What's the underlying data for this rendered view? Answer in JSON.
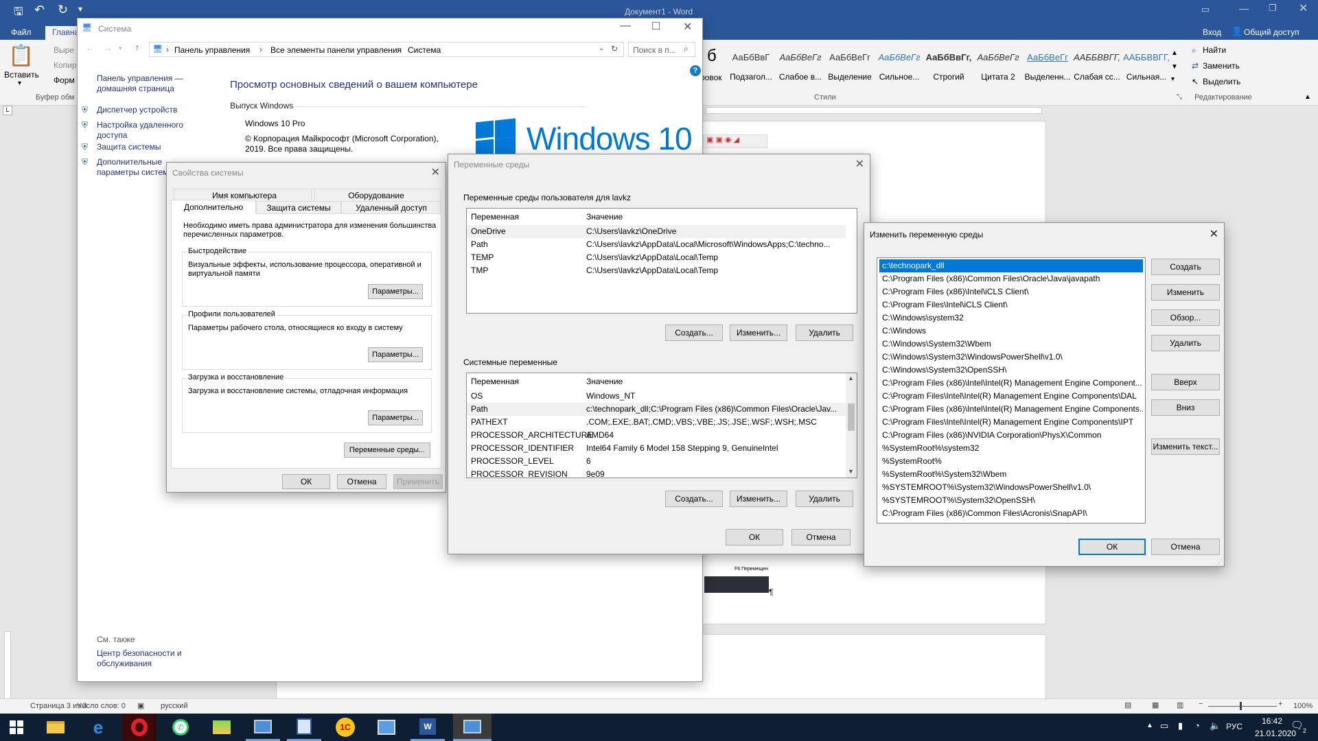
{
  "word": {
    "doc_title": "Документ1 - Word",
    "login": "Вход",
    "share": "Общий доступ",
    "tab_file": "Файл",
    "tab_home": "Главна",
    "paste": "Вставить",
    "cut": "Выре",
    "copy": "Копир",
    "format": "Форм",
    "clipboard": "Буфер обм",
    "styles_group": "Стили",
    "editing_group": "Редактирование",
    "find": "Найти",
    "replace": "Заменить",
    "select": "Выделить",
    "styles": [
      {
        "sample": "АаБбВвГ",
        "name": "Подзагол..."
      },
      {
        "sample": "АаБбВеГг",
        "name": "Слабое в..."
      },
      {
        "sample": "АаБбВеГг",
        "name": "Выделение"
      },
      {
        "sample": "АаБбВеГг",
        "name": "Сильное..."
      },
      {
        "sample": "АаБбВвГг,",
        "name": "Строгий"
      },
      {
        "sample": "АаБбВеГг",
        "name": "Цитата 2"
      },
      {
        "sample": "АаБбВеГг",
        "name": "Выделенн..."
      },
      {
        "sample": "ААББВВГГ,",
        "name": "Слабая сс..."
      },
      {
        "sample": "ААББВВГГ,",
        "name": "Сильная..."
      }
    ],
    "style_partial": "б",
    "style_partial_name": "ровок",
    "status": {
      "page": "Страница 3 из 3",
      "words": "Число слов: 0",
      "lang": "русский",
      "zoom": "100%"
    },
    "doc_text": "F6 Перемещен",
    "pilcrow": "¶"
  },
  "system": {
    "title": "Система",
    "breadcrumb": [
      "Панель управления",
      "Все элементы панели управления",
      "Система"
    ],
    "search_placeholder": "Поиск в п...",
    "cp_home": "Панель управления — домашняя страница",
    "links": [
      "Диспетчер устройств",
      "Настройка удаленного доступа",
      "Защита системы",
      "Дополнительные параметры системы"
    ],
    "heading": "Просмотр основных сведений о вашем компьютере",
    "edition_label": "Выпуск Windows",
    "edition": "Windows 10 Pro",
    "copyright": "© Корпорация Майкрософт (Microsoft Corporation), 2019. Все права защищены.",
    "logo_text": "Windows 10",
    "see_also": "См. также",
    "security_center": "Центр безопасности и обслуживания"
  },
  "sysprops": {
    "title": "Свойства системы",
    "tabs_top": [
      "Имя компьютера",
      "Оборудование"
    ],
    "tabs_bottom": [
      "Дополнительно",
      "Защита системы",
      "Удаленный доступ"
    ],
    "note": "Необходимо иметь права администратора для изменения большинства перечисленных параметров.",
    "perf_label": "Быстродействие",
    "perf_text": "Визуальные эффекты, использование процессора, оперативной и виртуальной памяти",
    "profiles_label": "Профили пользователей",
    "profiles_text": "Параметры рабочего стола, относящиеся ко входу в систему",
    "boot_label": "Загрузка и восстановление",
    "boot_text": "Загрузка и восстановление системы, отладочная информация",
    "params": "Параметры...",
    "env_vars": "Переменные среды...",
    "ok": "ОК",
    "cancel": "Отмена",
    "apply": "Применить"
  },
  "envvars": {
    "title": "Переменные среды",
    "user_label": "Переменные среды пользователя для lavkz",
    "col_var": "Переменная",
    "col_val": "Значение",
    "user_vars": [
      {
        "name": "OneDrive",
        "value": "C:\\Users\\lavkz\\OneDrive"
      },
      {
        "name": "Path",
        "value": "C:\\Users\\lavkz\\AppData\\Local\\Microsoft\\WindowsApps;C:\\techno..."
      },
      {
        "name": "TEMP",
        "value": "C:\\Users\\lavkz\\AppData\\Local\\Temp"
      },
      {
        "name": "TMP",
        "value": "C:\\Users\\lavkz\\AppData\\Local\\Temp"
      }
    ],
    "sys_label": "Системные переменные",
    "sys_vars": [
      {
        "name": "OS",
        "value": "Windows_NT"
      },
      {
        "name": "Path",
        "value": "c:\\technopark_dll;C:\\Program Files (x86)\\Common Files\\Oracle\\Jav..."
      },
      {
        "name": "PATHEXT",
        "value": ".COM;.EXE;.BAT;.CMD;.VBS;.VBE;.JS;.JSE;.WSF;.WSH;.MSC"
      },
      {
        "name": "PROCESSOR_ARCHITECTURE",
        "value": "AMD64"
      },
      {
        "name": "PROCESSOR_IDENTIFIER",
        "value": "Intel64 Family 6 Model 158 Stepping 9, GenuineIntel"
      },
      {
        "name": "PROCESSOR_LEVEL",
        "value": "6"
      },
      {
        "name": "PROCESSOR_REVISION",
        "value": "9e09"
      }
    ],
    "create": "Создать...",
    "edit": "Изменить...",
    "delete": "Удалить",
    "ok": "ОК",
    "cancel": "Отмена"
  },
  "editenv": {
    "title": "Изменить переменную среды",
    "items": [
      "c:\\technopark_dll",
      "C:\\Program Files (x86)\\Common Files\\Oracle\\Java\\javapath",
      "C:\\Program Files (x86)\\Intel\\iCLS Client\\",
      "C:\\Program Files\\Intel\\iCLS Client\\",
      "C:\\Windows\\system32",
      "C:\\Windows",
      "C:\\Windows\\System32\\Wbem",
      "C:\\Windows\\System32\\WindowsPowerShell\\v1.0\\",
      "C:\\Windows\\System32\\OpenSSH\\",
      "C:\\Program Files (x86)\\Intel\\Intel(R) Management Engine Component...",
      "C:\\Program Files\\Intel\\Intel(R) Management Engine Components\\DAL",
      "C:\\Program Files (x86)\\Intel\\Intel(R) Management Engine Components...",
      "C:\\Program Files\\Intel\\Intel(R) Management Engine Components\\IPT",
      "C:\\Program Files (x86)\\NVIDIA Corporation\\PhysX\\Common",
      "%SystemRoot%\\system32",
      "%SystemRoot%",
      "%SystemRoot%\\System32\\Wbem",
      "%SYSTEMROOT%\\System32\\WindowsPowerShell\\v1.0\\",
      "%SYSTEMROOT%\\System32\\OpenSSH\\",
      "C:\\Program Files (x86)\\Common Files\\Acronis\\SnapAPI\\"
    ],
    "create": "Создать",
    "edit": "Изменить",
    "browse": "Обзор...",
    "delete": "Удалить",
    "up": "Вверх",
    "down": "Вниз",
    "edit_text": "Изменить текст...",
    "ok": "ОК",
    "cancel": "Отмена"
  },
  "taskbar": {
    "lang": "РУС",
    "time": "16:42",
    "date": "21.01.2020",
    "notif_count": "2"
  },
  "colors": {
    "word_blue": "#2b579a",
    "taskbar": "#0f1f33",
    "selection": "#0078d7",
    "link": "#0066cc",
    "heading": "#1e3287"
  }
}
